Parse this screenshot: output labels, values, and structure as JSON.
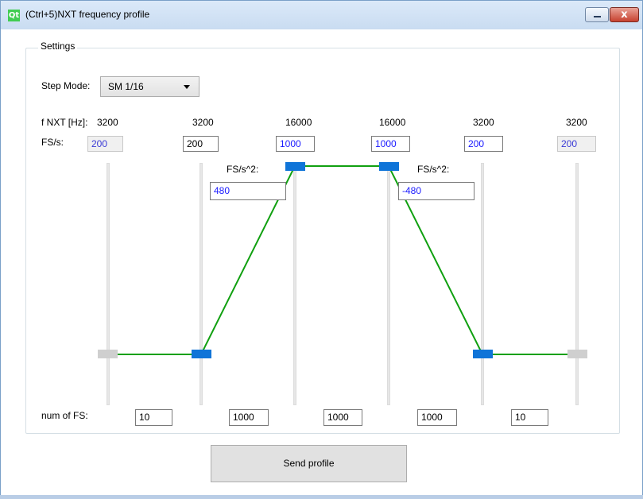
{
  "window": {
    "title": "(Ctrl+5)NXT frequency profile",
    "logo_text": "Qt",
    "close_glyph": "x"
  },
  "settings": {
    "group_title": "Settings"
  },
  "step_mode": {
    "label": "Step Mode:",
    "value": "SM 1/16"
  },
  "labels": {
    "frequency": "f NXT [Hz]:",
    "fs_per_s": "FS/s:",
    "accel": "FS/s^2:",
    "num_fs": "num of FS:"
  },
  "points": [
    {
      "freq": "3200",
      "fs_s": "200",
      "enabled": false
    },
    {
      "freq": "3200",
      "fs_s": "200",
      "enabled": true
    },
    {
      "freq": "16000",
      "fs_s": "1000",
      "enabled": true
    },
    {
      "freq": "16000",
      "fs_s": "1000",
      "enabled": true
    },
    {
      "freq": "3200",
      "fs_s": "200",
      "enabled": true
    },
    {
      "freq": "3200",
      "fs_s": "200",
      "enabled": false
    }
  ],
  "accelerations": [
    "480",
    "-480"
  ],
  "num_fs": [
    "10",
    "1000",
    "1000",
    "1000",
    "10"
  ],
  "send_button": {
    "label": "Send profile"
  },
  "colors": {
    "profile_line": "#10a010",
    "handle_active": "#0f74d8",
    "handle_inactive": "#cfcfcf"
  }
}
